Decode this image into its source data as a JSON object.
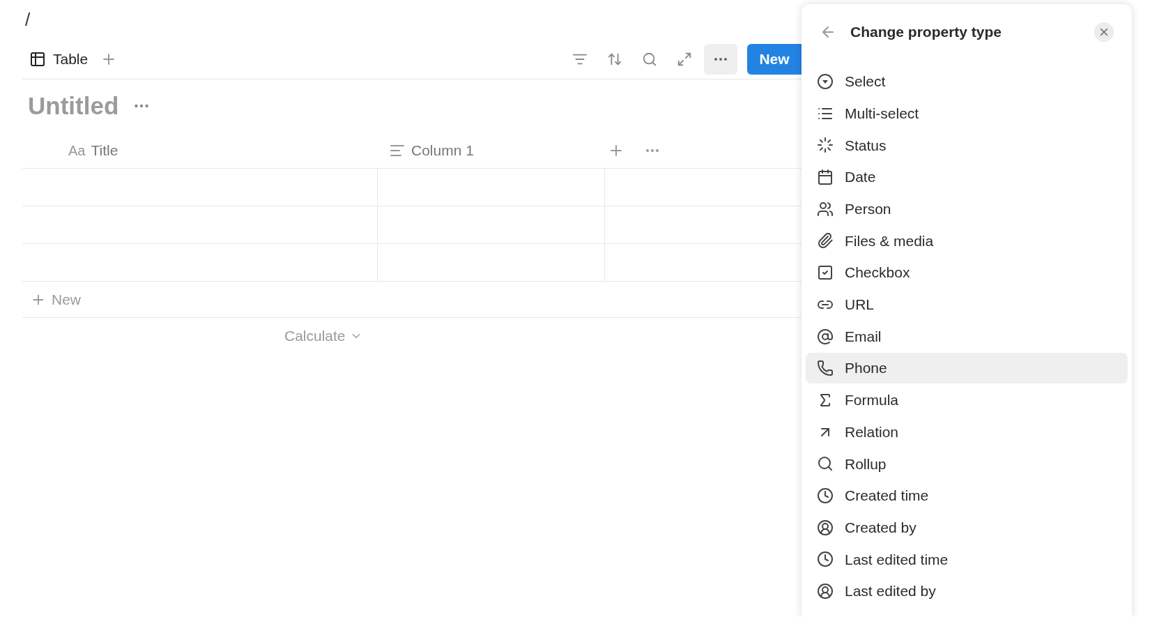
{
  "path": "/",
  "toolbar": {
    "view_tab": {
      "label": "Table",
      "selected": true
    },
    "new_button": "New"
  },
  "page_title": "Untitled",
  "columns": [
    {
      "label": "Title",
      "kind": "title",
      "type_glyph": "Aa"
    },
    {
      "label": "Column 1",
      "kind": "text"
    }
  ],
  "add_row": "New",
  "calculate": "Calculate",
  "panel": {
    "title": "Change property type",
    "items": [
      {
        "label": "Select",
        "kind": "select",
        "selected": false
      },
      {
        "label": "Multi-select",
        "kind": "multi",
        "selected": false
      },
      {
        "label": "Status",
        "kind": "status",
        "selected": false
      },
      {
        "label": "Date",
        "kind": "date",
        "selected": false
      },
      {
        "label": "Person",
        "kind": "person",
        "selected": false
      },
      {
        "label": "Files & media",
        "kind": "files",
        "selected": false
      },
      {
        "label": "Checkbox",
        "kind": "checkbox",
        "selected": false
      },
      {
        "label": "URL",
        "kind": "url",
        "selected": false
      },
      {
        "label": "Email",
        "kind": "email",
        "selected": false
      },
      {
        "label": "Phone",
        "kind": "phone",
        "selected": true
      },
      {
        "label": "Formula",
        "kind": "formula",
        "selected": false
      },
      {
        "label": "Relation",
        "kind": "relation",
        "selected": false
      },
      {
        "label": "Rollup",
        "kind": "rollup",
        "selected": false
      },
      {
        "label": "Created time",
        "kind": "time",
        "selected": false
      },
      {
        "label": "Created by",
        "kind": "user",
        "selected": false
      },
      {
        "label": "Last edited time",
        "kind": "time",
        "selected": false
      },
      {
        "label": "Last edited by",
        "kind": "user",
        "selected": false
      }
    ]
  }
}
